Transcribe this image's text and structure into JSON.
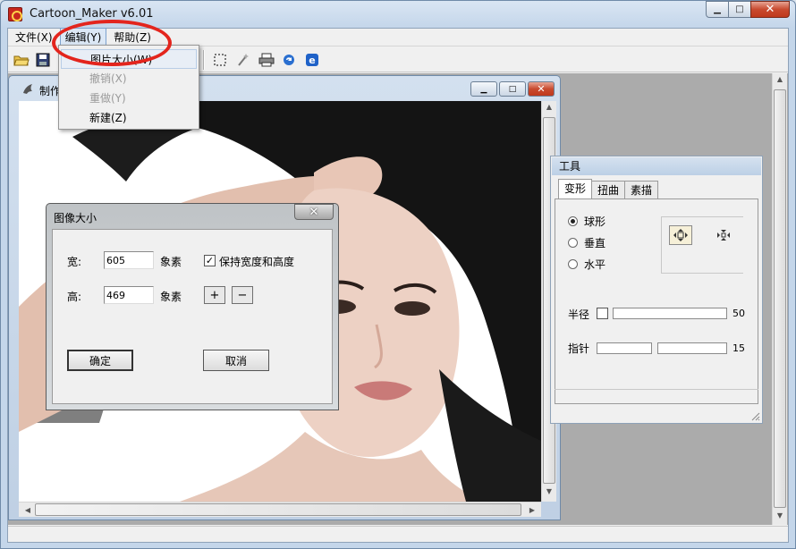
{
  "window": {
    "title": "Cartoon_Maker v6.01",
    "minimize_glyph": "▁",
    "maximize_glyph": "□",
    "close_glyph": "✕"
  },
  "menubar": {
    "items": [
      {
        "label": "文件(X)"
      },
      {
        "label": "编辑(Y)"
      },
      {
        "label": "帮助(Z)"
      }
    ]
  },
  "edit_menu": {
    "items": [
      {
        "label": "图片大小(W)",
        "enabled": true
      },
      {
        "label": "撤销(X)",
        "enabled": false
      },
      {
        "label": "重做(Y)",
        "enabled": false
      },
      {
        "label": "新建(Z)",
        "enabled": true
      }
    ]
  },
  "toolbar": {
    "icons": [
      "open-folder-icon",
      "save-disk-icon",
      "select-rect-icon",
      "magic-wand-icon",
      "printer-icon",
      "refresh-icon",
      "ie-globe-icon"
    ]
  },
  "child_window": {
    "title": "制作",
    "minimize_glyph": "▁",
    "maximize_glyph": "□",
    "close_glyph": "✕"
  },
  "dialog": {
    "title": "图像大小",
    "close_glyph": "✕",
    "width_label": "宽:",
    "width_value": "605",
    "height_label": "高:",
    "height_value": "469",
    "unit_label": "象素",
    "keep_ratio_label": "保持宽度和高度",
    "keep_ratio_checked": true,
    "plus_label": "+",
    "minus_label": "−",
    "ok_label": "确定",
    "cancel_label": "取消"
  },
  "tool_panel": {
    "title": "工具",
    "tabs": [
      "变形",
      "扭曲",
      "素描"
    ],
    "active_tab": 0,
    "options": [
      {
        "label": "球形",
        "selected": true
      },
      {
        "label": "垂直",
        "selected": false
      },
      {
        "label": "水平",
        "selected": false
      }
    ],
    "radius_label": "半径",
    "radius_value": "50",
    "pointer_label": "指针",
    "pointer_value": "15"
  },
  "colors": {
    "highlight_circle": "#e3251d",
    "title_gradient_top": "#d9e5f3"
  }
}
